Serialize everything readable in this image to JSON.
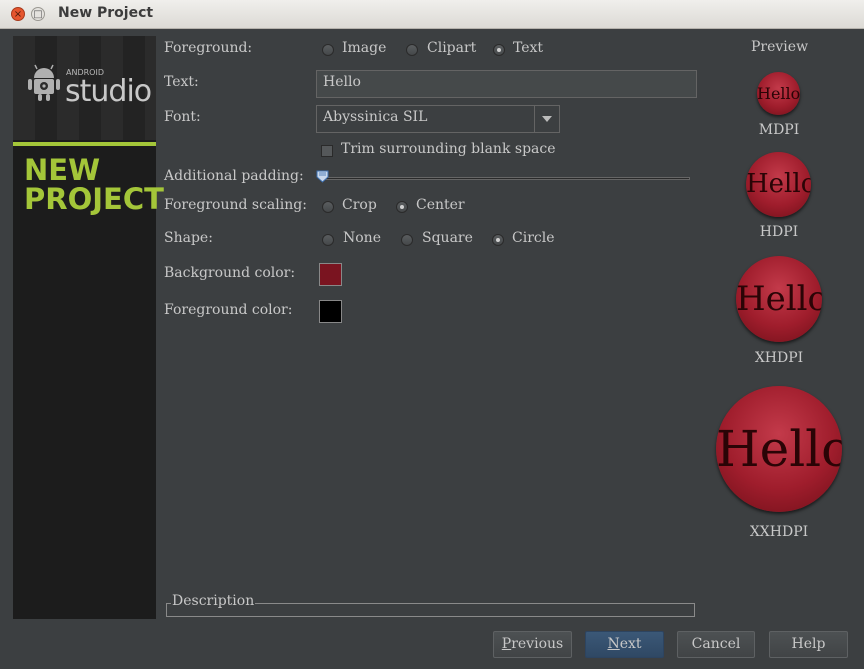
{
  "window": {
    "title": "New Project",
    "close_glyph": "×",
    "max_glyph": "□"
  },
  "sidebar": {
    "logo_small": "ANDROID",
    "logo_big": "studio",
    "title_line1": "NEW",
    "title_line2": "PROJECT"
  },
  "form": {
    "foreground_label": "Foreground:",
    "foreground_options": [
      "Image",
      "Clipart",
      "Text"
    ],
    "foreground_selected": "Text",
    "text_label": "Text:",
    "text_value": "Hello",
    "font_label": "Font:",
    "font_value": "Abyssinica SIL",
    "trim_label": "Trim surrounding blank space",
    "trim_checked": false,
    "padding_label": "Additional padding:",
    "padding_value": 0,
    "scaling_label": "Foreground scaling:",
    "scaling_options": [
      "Crop",
      "Center"
    ],
    "scaling_selected": "Center",
    "shape_label": "Shape:",
    "shape_options": [
      "None",
      "Square",
      "Circle"
    ],
    "shape_selected": "Circle",
    "bg_color_label": "Background color:",
    "bg_color": "#7a1420",
    "fg_color_label": "Foreground color:",
    "fg_color": "#000000"
  },
  "preview": {
    "title": "Preview",
    "icon_text": "Hello",
    "densities": [
      "MDPI",
      "HDPI",
      "XHDPI",
      "XXHDPI"
    ]
  },
  "description": {
    "label": "Description"
  },
  "buttons": {
    "previous_mn": "P",
    "previous_rest": "revious",
    "next_mn": "N",
    "next_rest": "ext",
    "cancel": "Cancel",
    "help": "Help"
  },
  "colors": {
    "accent_green": "#a4c639",
    "panel_bg": "#3c3f41",
    "primary_button": "#34506e"
  }
}
